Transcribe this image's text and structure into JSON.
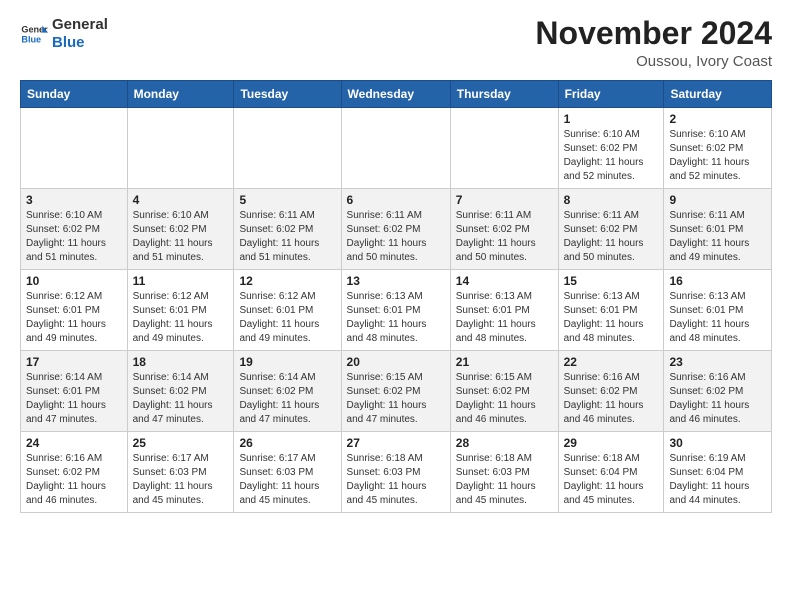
{
  "header": {
    "logo_general": "General",
    "logo_blue": "Blue",
    "month_title": "November 2024",
    "location": "Oussou, Ivory Coast"
  },
  "days_of_week": [
    "Sunday",
    "Monday",
    "Tuesday",
    "Wednesday",
    "Thursday",
    "Friday",
    "Saturday"
  ],
  "weeks": [
    [
      {
        "day": "",
        "info": ""
      },
      {
        "day": "",
        "info": ""
      },
      {
        "day": "",
        "info": ""
      },
      {
        "day": "",
        "info": ""
      },
      {
        "day": "",
        "info": ""
      },
      {
        "day": "1",
        "info": "Sunrise: 6:10 AM\nSunset: 6:02 PM\nDaylight: 11 hours\nand 52 minutes."
      },
      {
        "day": "2",
        "info": "Sunrise: 6:10 AM\nSunset: 6:02 PM\nDaylight: 11 hours\nand 52 minutes."
      }
    ],
    [
      {
        "day": "3",
        "info": "Sunrise: 6:10 AM\nSunset: 6:02 PM\nDaylight: 11 hours\nand 51 minutes."
      },
      {
        "day": "4",
        "info": "Sunrise: 6:10 AM\nSunset: 6:02 PM\nDaylight: 11 hours\nand 51 minutes."
      },
      {
        "day": "5",
        "info": "Sunrise: 6:11 AM\nSunset: 6:02 PM\nDaylight: 11 hours\nand 51 minutes."
      },
      {
        "day": "6",
        "info": "Sunrise: 6:11 AM\nSunset: 6:02 PM\nDaylight: 11 hours\nand 50 minutes."
      },
      {
        "day": "7",
        "info": "Sunrise: 6:11 AM\nSunset: 6:02 PM\nDaylight: 11 hours\nand 50 minutes."
      },
      {
        "day": "8",
        "info": "Sunrise: 6:11 AM\nSunset: 6:02 PM\nDaylight: 11 hours\nand 50 minutes."
      },
      {
        "day": "9",
        "info": "Sunrise: 6:11 AM\nSunset: 6:01 PM\nDaylight: 11 hours\nand 49 minutes."
      }
    ],
    [
      {
        "day": "10",
        "info": "Sunrise: 6:12 AM\nSunset: 6:01 PM\nDaylight: 11 hours\nand 49 minutes."
      },
      {
        "day": "11",
        "info": "Sunrise: 6:12 AM\nSunset: 6:01 PM\nDaylight: 11 hours\nand 49 minutes."
      },
      {
        "day": "12",
        "info": "Sunrise: 6:12 AM\nSunset: 6:01 PM\nDaylight: 11 hours\nand 49 minutes."
      },
      {
        "day": "13",
        "info": "Sunrise: 6:13 AM\nSunset: 6:01 PM\nDaylight: 11 hours\nand 48 minutes."
      },
      {
        "day": "14",
        "info": "Sunrise: 6:13 AM\nSunset: 6:01 PM\nDaylight: 11 hours\nand 48 minutes."
      },
      {
        "day": "15",
        "info": "Sunrise: 6:13 AM\nSunset: 6:01 PM\nDaylight: 11 hours\nand 48 minutes."
      },
      {
        "day": "16",
        "info": "Sunrise: 6:13 AM\nSunset: 6:01 PM\nDaylight: 11 hours\nand 48 minutes."
      }
    ],
    [
      {
        "day": "17",
        "info": "Sunrise: 6:14 AM\nSunset: 6:01 PM\nDaylight: 11 hours\nand 47 minutes."
      },
      {
        "day": "18",
        "info": "Sunrise: 6:14 AM\nSunset: 6:02 PM\nDaylight: 11 hours\nand 47 minutes."
      },
      {
        "day": "19",
        "info": "Sunrise: 6:14 AM\nSunset: 6:02 PM\nDaylight: 11 hours\nand 47 minutes."
      },
      {
        "day": "20",
        "info": "Sunrise: 6:15 AM\nSunset: 6:02 PM\nDaylight: 11 hours\nand 47 minutes."
      },
      {
        "day": "21",
        "info": "Sunrise: 6:15 AM\nSunset: 6:02 PM\nDaylight: 11 hours\nand 46 minutes."
      },
      {
        "day": "22",
        "info": "Sunrise: 6:16 AM\nSunset: 6:02 PM\nDaylight: 11 hours\nand 46 minutes."
      },
      {
        "day": "23",
        "info": "Sunrise: 6:16 AM\nSunset: 6:02 PM\nDaylight: 11 hours\nand 46 minutes."
      }
    ],
    [
      {
        "day": "24",
        "info": "Sunrise: 6:16 AM\nSunset: 6:02 PM\nDaylight: 11 hours\nand 46 minutes."
      },
      {
        "day": "25",
        "info": "Sunrise: 6:17 AM\nSunset: 6:03 PM\nDaylight: 11 hours\nand 45 minutes."
      },
      {
        "day": "26",
        "info": "Sunrise: 6:17 AM\nSunset: 6:03 PM\nDaylight: 11 hours\nand 45 minutes."
      },
      {
        "day": "27",
        "info": "Sunrise: 6:18 AM\nSunset: 6:03 PM\nDaylight: 11 hours\nand 45 minutes."
      },
      {
        "day": "28",
        "info": "Sunrise: 6:18 AM\nSunset: 6:03 PM\nDaylight: 11 hours\nand 45 minutes."
      },
      {
        "day": "29",
        "info": "Sunrise: 6:18 AM\nSunset: 6:04 PM\nDaylight: 11 hours\nand 45 minutes."
      },
      {
        "day": "30",
        "info": "Sunrise: 6:19 AM\nSunset: 6:04 PM\nDaylight: 11 hours\nand 44 minutes."
      }
    ]
  ]
}
